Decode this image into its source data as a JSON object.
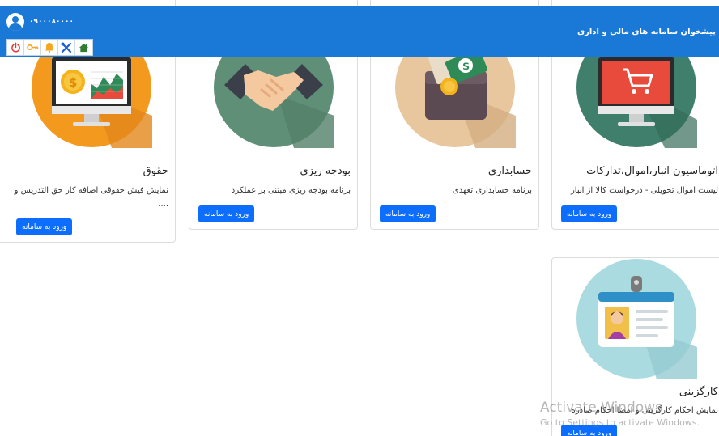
{
  "header": {
    "brand": "پیشخوان سامانه های مالی و اداری",
    "user_id": "۰۹۰۰۰۸۰۰۰۰"
  },
  "toolbar": {
    "items": [
      {
        "name": "power-icon",
        "color": "#e53935"
      },
      {
        "name": "key-icon",
        "color": "#f5a623"
      },
      {
        "name": "bell-icon",
        "color": "#f5a623"
      },
      {
        "name": "tools-icon",
        "color": "#1a5fd6"
      },
      {
        "name": "home-icon",
        "color": "#2e7d32"
      }
    ]
  },
  "cards": [
    {
      "title": "اتوماسیون انبار،اموال،تدارکات",
      "desc": "لیست اموال تحویلی - درخواست کالا از انبار",
      "button": "ورود به سامانه"
    },
    {
      "title": "حسابداری",
      "desc": "برنامه حسابداری تعهدی",
      "button": "ورود به سامانه"
    },
    {
      "title": "بودجه ریزی",
      "desc": "برنامه بودجه ریزی مبتنی بر عملکرد",
      "button": "ورود به سامانه"
    },
    {
      "title": "حقوق",
      "desc": "نمایش فیش حقوقی اضافه کار حق التدریس و ....",
      "button": "ورود به سامانه"
    },
    {
      "title": "کارگزینی",
      "desc": "نمایش احکام کارگزینی و امضا احکام صادره",
      "button": "ورود به سامانه"
    }
  ],
  "watermark": {
    "line1": "Activate Windows",
    "line2": "Go to Settings to activate Windows."
  }
}
